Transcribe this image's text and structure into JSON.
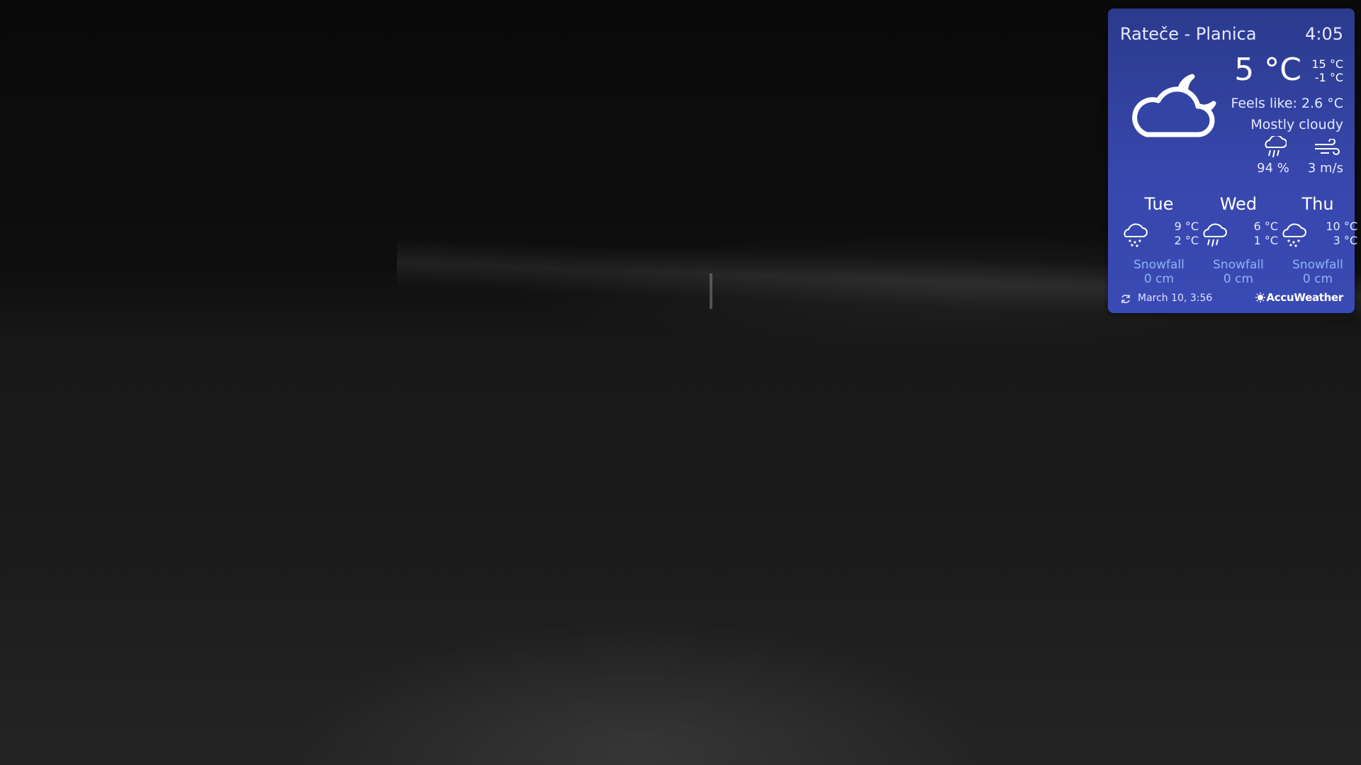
{
  "weather": {
    "location": "Rateče - Planica",
    "time": "4:05",
    "current_icon": "cloud-moon-icon",
    "temperature": "5 °C",
    "high": "15 °C",
    "low": "-1 °C",
    "feels_like": "Feels like: 2.6 °C",
    "condition": "Mostly cloudy",
    "precip_icon": "rain-icon",
    "precipitation": "94 %",
    "wind_icon": "wind-icon",
    "wind": "3 m/s",
    "forecast": [
      {
        "day": "Tue",
        "icon": "snow-cloud-icon",
        "high": "9 °C",
        "low": "2 °C",
        "snow_label": "Snowfall",
        "snow_value": "0 cm"
      },
      {
        "day": "Wed",
        "icon": "rain-cloud-icon",
        "high": "6 °C",
        "low": "1 °C",
        "snow_label": "Snowfall",
        "snow_value": "0 cm"
      },
      {
        "day": "Thu",
        "icon": "snow-cloud-icon",
        "high": "10 °C",
        "low": "3 °C",
        "snow_label": "Snowfall",
        "snow_value": "0 cm"
      }
    ],
    "updated": "March 10, 3:56",
    "refresh_icon": "refresh-icon",
    "provider": "AccuWeather",
    "colors": {
      "panel_top": "#2b3a8c",
      "panel_bottom": "#3a4ab4",
      "snow_text": "#8fb3f2"
    }
  }
}
